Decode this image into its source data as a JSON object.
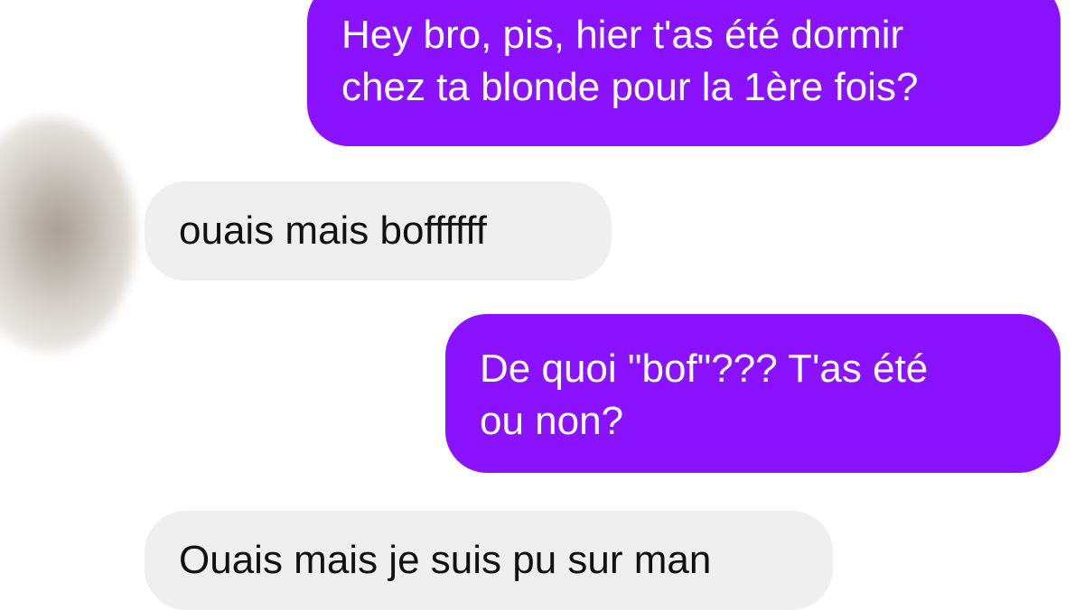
{
  "conversation": {
    "messages": [
      {
        "sender": "me",
        "lines": [
          "Hey bro, pis, hier t'as été dormir",
          "chez ta blonde pour la 1ère fois?"
        ]
      },
      {
        "sender": "friend",
        "lines": [
          "ouais mais boffffff"
        ]
      },
      {
        "sender": "me",
        "lines": [
          "De quoi \"bof\"??? T'as été",
          "ou non?"
        ]
      },
      {
        "sender": "friend",
        "lines": [
          "Ouais mais je suis pu sur man"
        ]
      }
    ]
  },
  "colors": {
    "sent_bubble": "#8a12ff",
    "received_bubble": "#efefef",
    "sent_text": "#ffffff",
    "received_text": "#111111"
  },
  "icons": {
    "avatar": "blurred-contact-avatar"
  }
}
